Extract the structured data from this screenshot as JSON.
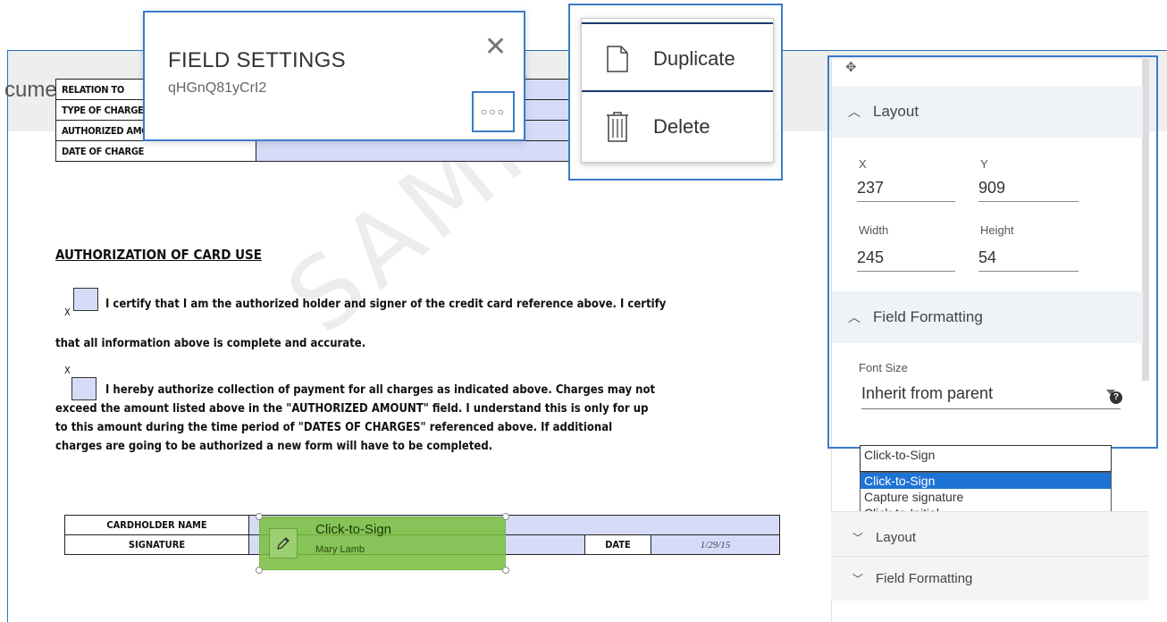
{
  "header": {
    "title": "cuments"
  },
  "document": {
    "watermark": "SAMPLE",
    "top_table": [
      {
        "label": "RELATION TO",
        "value": ""
      },
      {
        "label": "TYPE OF CHARGES",
        "value": ""
      },
      {
        "label": "AUTHORIZED AMOUNT",
        "value": ""
      },
      {
        "label": "DATE OF CHARGE",
        "value": ""
      }
    ],
    "auth_heading": "AUTHORIZATION OF CARD USE",
    "x_mark": "X",
    "para1_line1": "I certify that I am the authorized holder and signer of the credit card reference above. I certify",
    "para1_line2": "that all information above is complete and accurate.",
    "para2_line1": "I hereby authorize collection of payment for all charges as indicated above. Charges may not",
    "para2_line2": "exceed the amount listed above in the \"AUTHORIZED AMOUNT\" field.  I understand  this is only for up",
    "para2_line3": "to this amount during the time period of \"DATES OF CHARGES\" referenced above. If additional",
    "para2_line4": "charges are going to be authorized a new form will have to be completed.",
    "bottom_table": {
      "cardholder_label": "CARDHOLDER NAME",
      "signature_label": "SIGNATURE",
      "date_label": "DATE",
      "date_value": "1/29/15"
    }
  },
  "signature_field": {
    "type_label": "Click-to-Sign",
    "signer_name": "Mary Lamb"
  },
  "field_settings": {
    "title": "FIELD SETTINGS",
    "field_id": "qHGnQ81yCrI2",
    "close_glyph": "✕",
    "more_glyph": "○○○"
  },
  "context_menu": {
    "duplicate_label": "Duplicate",
    "delete_label": "Delete"
  },
  "properties_panel": {
    "move_glyph": "✥",
    "layout_section": "Layout",
    "x_label": "X",
    "x_value": "237",
    "y_label": "Y",
    "y_value": "909",
    "width_label": "Width",
    "width_value": "245",
    "height_label": "Height",
    "height_value": "54",
    "formatting_section": "Field Formatting",
    "font_size_label": "Font Size",
    "font_size_value": "Inherit from parent",
    "help_glyph": "?"
  },
  "signature_type_select": {
    "selected": "Click-to-Sign",
    "options": [
      "Click-to-Sign",
      "Capture signature",
      "Click-to-Initial"
    ]
  },
  "collapsed_sections": {
    "layout": "Layout",
    "formatting": "Field Formatting"
  },
  "colors": {
    "accent": "#3a7bc8",
    "field_fill": "#d6dcf8",
    "signature_fill": "#8cc552",
    "selected_option": "#1e73d6"
  }
}
